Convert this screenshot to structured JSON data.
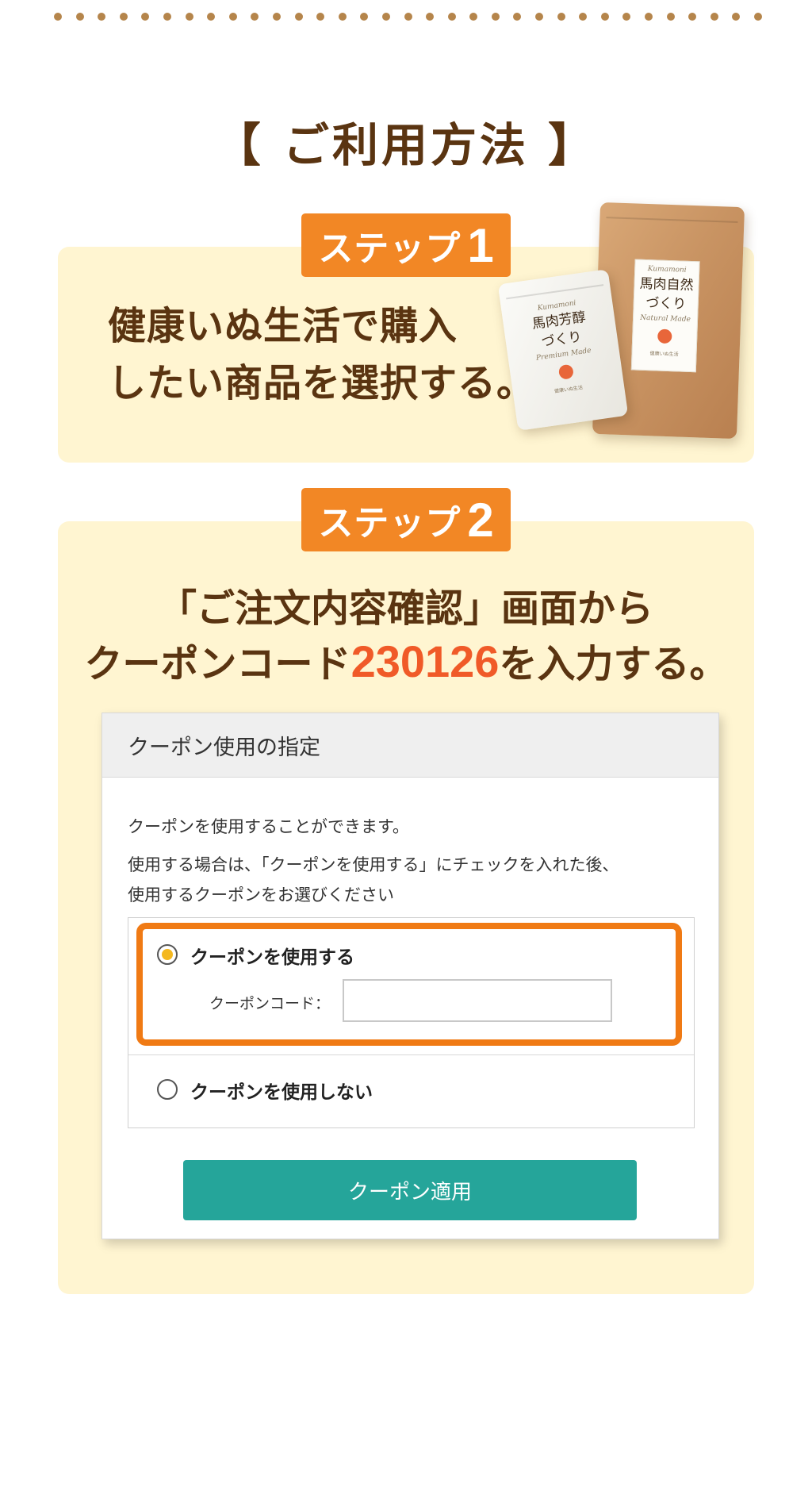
{
  "section_title": "【 ご利用方法 】",
  "step1": {
    "badge_word": "ステップ",
    "badge_num": "1",
    "text_line1": "健康いぬ生活で購入",
    "text_line2": "したい商品を選択する。",
    "products": [
      {
        "brand": "Kumamoni",
        "name_line1": "馬肉自然",
        "name_line2": "づくり",
        "subtitle": "Natural Made",
        "tiny": "健康いぬ生活"
      },
      {
        "brand": "Kumamoni",
        "name_line1": "馬肉芳醇",
        "name_line2": "づくり",
        "subtitle": "Premium Made",
        "tiny": "健康いぬ生活"
      }
    ]
  },
  "step2": {
    "badge_word": "ステップ",
    "badge_num": "2",
    "line1": "「ご注文内容確認」画面から",
    "line2_pre": "クーポンコード",
    "code": "230126",
    "line2_post": "を入力する。",
    "panel": {
      "title": "クーポン使用の指定",
      "desc1": "クーポンを使用することができます。",
      "desc2_line1": "使用する場合は、「クーポンを使用する」にチェックを入れた後、",
      "desc2_line2": "使用するクーポンをお選びください",
      "option_use": "クーポンを使用する",
      "code_label": "クーポンコード：",
      "code_value": "",
      "option_no": "クーポンを使用しない",
      "selected_option": "use",
      "apply_button": "クーポン適用"
    }
  },
  "colors": {
    "brown_text": "#5a3411",
    "badge_orange": "#f28725",
    "card_cream": "#fff5d1",
    "code_red": "#f05a28",
    "highlight_orange": "#f07a14",
    "apply_teal": "#25a59a",
    "dot_brown": "#b5854b"
  }
}
